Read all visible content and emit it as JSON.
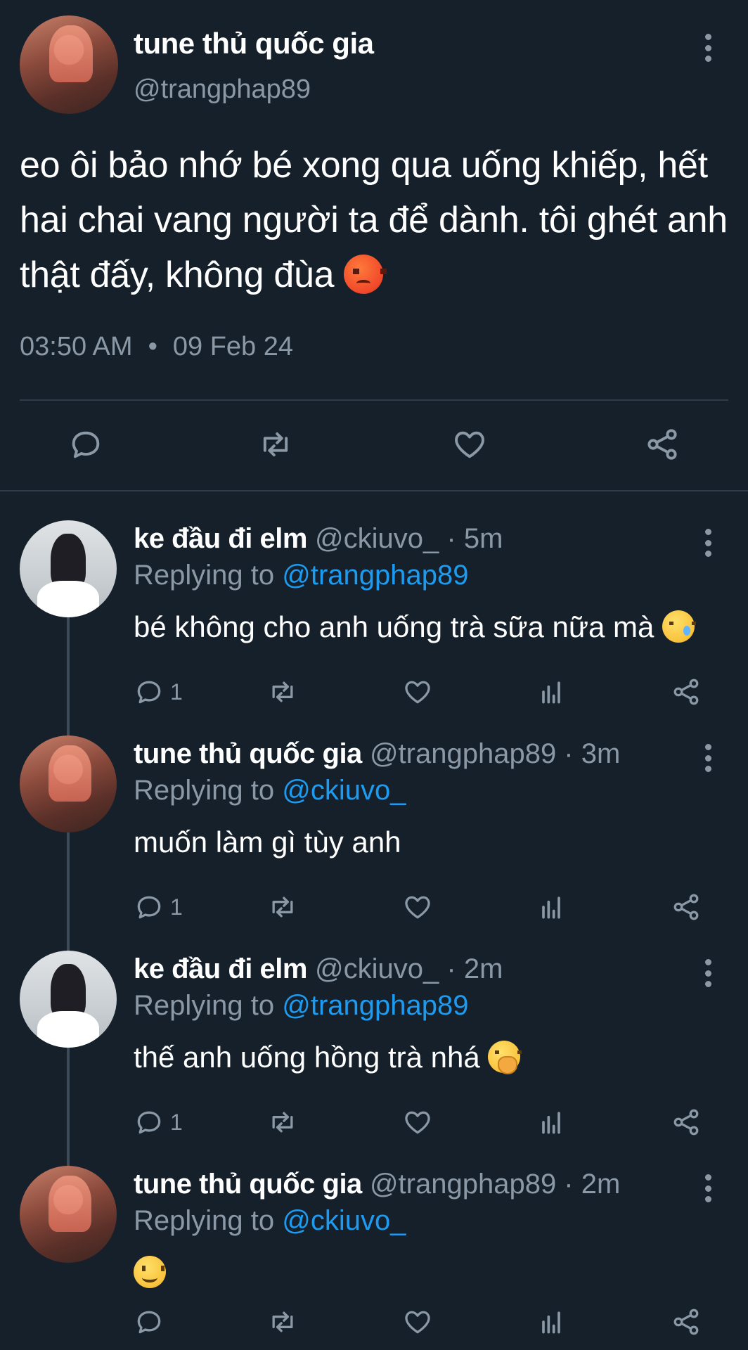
{
  "main_tweet": {
    "display_name": "tune thủ quốc gia",
    "handle": "@trangphap89",
    "text": "eo ôi bảo nhớ bé xong qua uống khiếp, hết hai chai vang người ta để dành. tôi ghét anh thật đấy, không đùa",
    "emoji": "angry-face-emoji",
    "time": "03:50 AM",
    "separator": "•",
    "date": "09 Feb 24",
    "actions": [
      "reply-icon",
      "retweet-icon",
      "like-icon",
      "share-icon"
    ]
  },
  "replies": [
    {
      "display_name": "ke đầu đi elm",
      "handle_time": "@ckiuvo_ · 5m",
      "replying_label": "Replying to",
      "replying_to": "@trangphap89",
      "text": "bé không cho anh uống trà sữa nữa mà",
      "emoji": "crying-face-emoji",
      "reply_count": "1",
      "avatar": "boy"
    },
    {
      "display_name": "tune thủ quốc gia",
      "handle_time": "@trangphap89 · 3m",
      "replying_label": "Replying to",
      "replying_to": "@ckiuvo_",
      "text": "muốn làm gì tùy anh",
      "emoji": "",
      "reply_count": "1",
      "avatar": "girl"
    },
    {
      "display_name": "ke đầu đi elm",
      "handle_time": "@ckiuvo_ · 2m",
      "replying_label": "Replying to",
      "replying_to": "@trangphap89",
      "text": "thế anh uống hồng trà nhá",
      "emoji": "hand-over-mouth-emoji",
      "reply_count": "1",
      "avatar": "boy"
    },
    {
      "display_name": "tune thủ quốc gia",
      "handle_time": "@trangphap89 · 2m",
      "replying_label": "Replying to",
      "replying_to": "@ckiuvo_",
      "text": "",
      "emoji": "slightly-smiling-face-emoji",
      "reply_count": "",
      "avatar": "girl"
    }
  ],
  "colors": {
    "background": "#15202b",
    "secondary_text": "#8b98a5",
    "link": "#1d9bf0",
    "divider": "#2f3b47"
  }
}
